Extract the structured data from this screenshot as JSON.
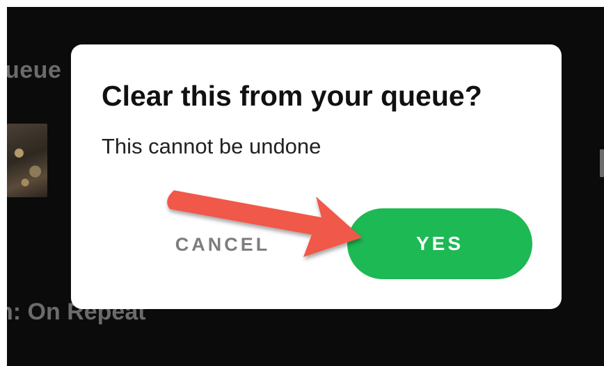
{
  "background": {
    "queue_label": "ueue",
    "playlist_label": "n: On Repeat"
  },
  "dialog": {
    "title": "Clear this from your queue?",
    "message": "This cannot be undone",
    "cancel_label": "CANCEL",
    "confirm_label": "YES"
  },
  "colors": {
    "confirm_button": "#1db954",
    "annotation_arrow": "#f0584a",
    "app_background": "#0b0b0b"
  }
}
